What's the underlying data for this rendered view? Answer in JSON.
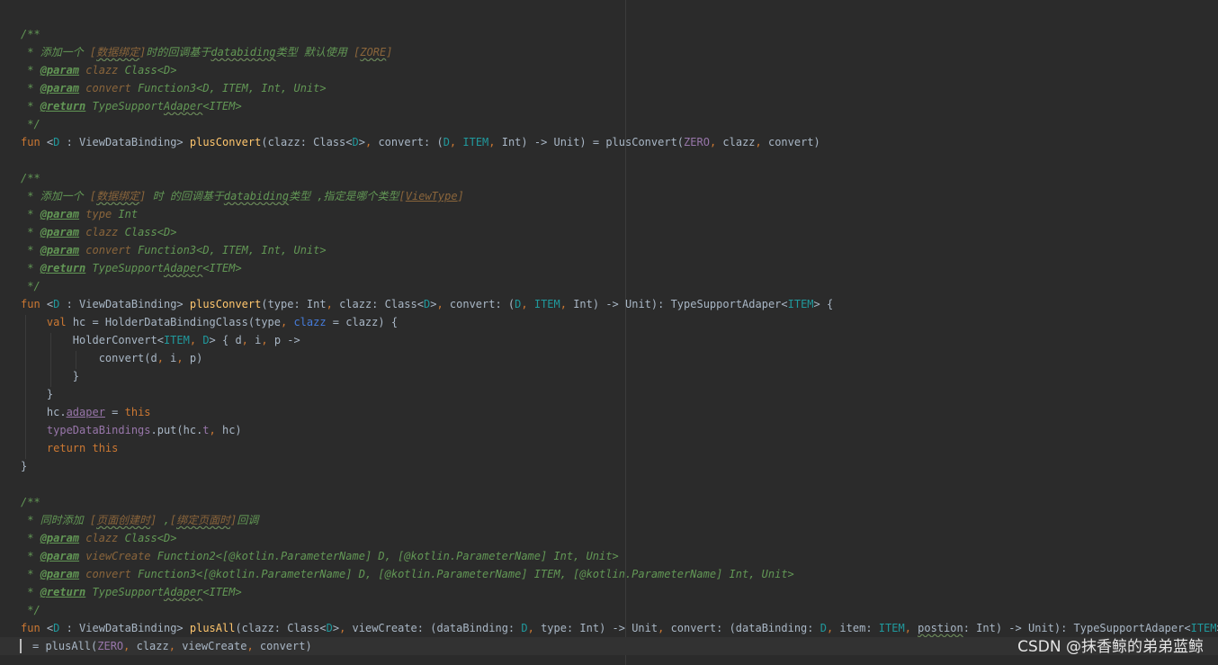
{
  "editor": {
    "watermark": "CSDN @抹香鲸的弟弟蓝鲸",
    "lines": [
      {
        "tokens": [
          {
            "t": "/**",
            "c": "comment"
          }
        ]
      },
      {
        "tokens": [
          {
            "t": " * 添加一个 ",
            "c": "comment"
          },
          {
            "t": "[",
            "c": "doc-link"
          },
          {
            "t": "数据绑定",
            "c": "doc-link",
            "u": "squiggle"
          },
          {
            "t": "]",
            "c": "doc-link"
          },
          {
            "t": "时的回调基于",
            "c": "comment"
          },
          {
            "t": "databiding",
            "c": "comment",
            "u": "squiggle"
          },
          {
            "t": "类型 默认使用 ",
            "c": "comment"
          },
          {
            "t": "[",
            "c": "doc-link"
          },
          {
            "t": "ZORE",
            "c": "doc-link",
            "u": "squiggle"
          },
          {
            "t": "]",
            "c": "doc-link"
          }
        ]
      },
      {
        "tokens": [
          {
            "t": " * ",
            "c": "comment"
          },
          {
            "t": "@param",
            "c": "tag"
          },
          {
            "t": " ",
            "c": "comment"
          },
          {
            "t": "clazz",
            "c": "doc-param"
          },
          {
            "t": " Class<D>",
            "c": "comment"
          }
        ]
      },
      {
        "tokens": [
          {
            "t": " * ",
            "c": "comment"
          },
          {
            "t": "@param",
            "c": "tag"
          },
          {
            "t": " ",
            "c": "comment"
          },
          {
            "t": "convert",
            "c": "doc-param"
          },
          {
            "t": " Function3<D, ITEM, Int, Unit>",
            "c": "comment"
          }
        ]
      },
      {
        "tokens": [
          {
            "t": " * ",
            "c": "comment"
          },
          {
            "t": "@return",
            "c": "tag"
          },
          {
            "t": " TypeSupport",
            "c": "comment"
          },
          {
            "t": "Adaper",
            "c": "comment",
            "u": "squiggle"
          },
          {
            "t": "<ITEM>",
            "c": "comment"
          }
        ]
      },
      {
        "tokens": [
          {
            "t": " */",
            "c": "comment"
          }
        ]
      },
      {
        "tokens": [
          {
            "t": "fun ",
            "c": "kw"
          },
          {
            "t": "<",
            "c": "plain"
          },
          {
            "t": "D",
            "c": "tp"
          },
          {
            "t": " : ViewDataBinding> ",
            "c": "plain"
          },
          {
            "t": "plusConvert",
            "c": "fn"
          },
          {
            "t": "(clazz: Class<",
            "c": "plain"
          },
          {
            "t": "D",
            "c": "tp"
          },
          {
            "t": ">",
            "c": "plain"
          },
          {
            "t": ", ",
            "c": "kw"
          },
          {
            "t": "convert: (",
            "c": "plain"
          },
          {
            "t": "D",
            "c": "tp"
          },
          {
            "t": ", ",
            "c": "kw"
          },
          {
            "t": "ITEM",
            "c": "tp"
          },
          {
            "t": ", ",
            "c": "kw"
          },
          {
            "t": "Int) -> Unit) = plusConvert(",
            "c": "plain"
          },
          {
            "t": "ZERO",
            "c": "prop"
          },
          {
            "t": ", ",
            "c": "kw"
          },
          {
            "t": "clazz",
            "c": "plain"
          },
          {
            "t": ", ",
            "c": "kw"
          },
          {
            "t": "convert)",
            "c": "plain"
          }
        ]
      },
      {
        "tokens": []
      },
      {
        "tokens": [
          {
            "t": "/**",
            "c": "comment"
          }
        ]
      },
      {
        "tokens": [
          {
            "t": " * 添加一个 ",
            "c": "comment"
          },
          {
            "t": "[",
            "c": "doc-link"
          },
          {
            "t": "数据绑定",
            "c": "doc-link",
            "u": "squiggle"
          },
          {
            "t": "]",
            "c": "doc-link"
          },
          {
            "t": " 时 的回调基于",
            "c": "comment"
          },
          {
            "t": "databiding",
            "c": "comment",
            "u": "squiggle"
          },
          {
            "t": "类型 ,指定是哪个类型",
            "c": "comment"
          },
          {
            "t": "[",
            "c": "doc-link"
          },
          {
            "t": "ViewType",
            "c": "doc-link",
            "u": "underline"
          },
          {
            "t": "]",
            "c": "doc-link"
          }
        ]
      },
      {
        "tokens": [
          {
            "t": " * ",
            "c": "comment"
          },
          {
            "t": "@param",
            "c": "tag"
          },
          {
            "t": " ",
            "c": "comment"
          },
          {
            "t": "type",
            "c": "doc-param"
          },
          {
            "t": " Int",
            "c": "comment"
          }
        ]
      },
      {
        "tokens": [
          {
            "t": " * ",
            "c": "comment"
          },
          {
            "t": "@param",
            "c": "tag"
          },
          {
            "t": " ",
            "c": "comment"
          },
          {
            "t": "clazz",
            "c": "doc-param"
          },
          {
            "t": " Class<D>",
            "c": "comment"
          }
        ]
      },
      {
        "tokens": [
          {
            "t": " * ",
            "c": "comment"
          },
          {
            "t": "@param",
            "c": "tag"
          },
          {
            "t": " ",
            "c": "comment"
          },
          {
            "t": "convert",
            "c": "doc-param"
          },
          {
            "t": " Function3<D, ITEM, Int, Unit>",
            "c": "comment"
          }
        ]
      },
      {
        "tokens": [
          {
            "t": " * ",
            "c": "comment"
          },
          {
            "t": "@return",
            "c": "tag"
          },
          {
            "t": " TypeSupport",
            "c": "comment"
          },
          {
            "t": "Adaper",
            "c": "comment",
            "u": "squiggle"
          },
          {
            "t": "<ITEM>",
            "c": "comment"
          }
        ]
      },
      {
        "tokens": [
          {
            "t": " */",
            "c": "comment"
          }
        ]
      },
      {
        "tokens": [
          {
            "t": "fun ",
            "c": "kw"
          },
          {
            "t": "<",
            "c": "plain"
          },
          {
            "t": "D",
            "c": "tp"
          },
          {
            "t": " : ViewDataBinding> ",
            "c": "plain"
          },
          {
            "t": "plusConvert",
            "c": "fn"
          },
          {
            "t": "(type: Int",
            "c": "plain"
          },
          {
            "t": ", ",
            "c": "kw"
          },
          {
            "t": "clazz: Class<",
            "c": "plain"
          },
          {
            "t": "D",
            "c": "tp"
          },
          {
            "t": ">",
            "c": "plain"
          },
          {
            "t": ", ",
            "c": "kw"
          },
          {
            "t": "convert: (",
            "c": "plain"
          },
          {
            "t": "D",
            "c": "tp"
          },
          {
            "t": ", ",
            "c": "kw"
          },
          {
            "t": "ITEM",
            "c": "tp"
          },
          {
            "t": ", ",
            "c": "kw"
          },
          {
            "t": "Int) -> Unit): TypeSupportAdaper<",
            "c": "plain"
          },
          {
            "t": "ITEM",
            "c": "tp"
          },
          {
            "t": "> {",
            "c": "plain"
          }
        ]
      },
      {
        "tokens": [
          {
            "t": "    ",
            "c": "plain"
          },
          {
            "t": "val ",
            "c": "kw"
          },
          {
            "t": "hc = HolderDataBindingClass(type",
            "c": "plain"
          },
          {
            "t": ", ",
            "c": "kw"
          },
          {
            "t": "clazz",
            "c": "named"
          },
          {
            "t": " = clazz) {",
            "c": "plain"
          }
        ]
      },
      {
        "tokens": [
          {
            "t": "        HolderConvert<",
            "c": "plain"
          },
          {
            "t": "ITEM",
            "c": "tp"
          },
          {
            "t": ", ",
            "c": "kw"
          },
          {
            "t": "D",
            "c": "tp"
          },
          {
            "t": "> { d",
            "c": "plain"
          },
          {
            "t": ", ",
            "c": "kw"
          },
          {
            "t": "i",
            "c": "plain"
          },
          {
            "t": ", ",
            "c": "kw"
          },
          {
            "t": "p ->",
            "c": "plain"
          }
        ]
      },
      {
        "tokens": [
          {
            "t": "            convert(d",
            "c": "plain"
          },
          {
            "t": ", ",
            "c": "kw"
          },
          {
            "t": "i",
            "c": "plain"
          },
          {
            "t": ", ",
            "c": "kw"
          },
          {
            "t": "p)",
            "c": "plain"
          }
        ]
      },
      {
        "tokens": [
          {
            "t": "        }",
            "c": "plain"
          }
        ]
      },
      {
        "tokens": [
          {
            "t": "    }",
            "c": "plain"
          }
        ]
      },
      {
        "tokens": [
          {
            "t": "    hc.",
            "c": "plain"
          },
          {
            "t": "adaper",
            "c": "prop",
            "u": "underline"
          },
          {
            "t": " = ",
            "c": "plain"
          },
          {
            "t": "this",
            "c": "kw"
          }
        ]
      },
      {
        "tokens": [
          {
            "t": "    ",
            "c": "plain"
          },
          {
            "t": "typeDataBindings",
            "c": "prop"
          },
          {
            "t": ".put(hc.",
            "c": "plain"
          },
          {
            "t": "t",
            "c": "prop"
          },
          {
            "t": ", ",
            "c": "kw"
          },
          {
            "t": "hc)",
            "c": "plain"
          }
        ]
      },
      {
        "tokens": [
          {
            "t": "    ",
            "c": "plain"
          },
          {
            "t": "return this",
            "c": "kw"
          }
        ]
      },
      {
        "tokens": [
          {
            "t": "}",
            "c": "plain"
          }
        ]
      },
      {
        "tokens": []
      },
      {
        "tokens": [
          {
            "t": "/**",
            "c": "comment"
          }
        ]
      },
      {
        "tokens": [
          {
            "t": " * 同时添加 ",
            "c": "comment"
          },
          {
            "t": "[",
            "c": "doc-link"
          },
          {
            "t": "页面创建时",
            "c": "doc-link",
            "u": "squiggle"
          },
          {
            "t": "]",
            "c": "doc-link"
          },
          {
            "t": " ,",
            "c": "comment"
          },
          {
            "t": "[",
            "c": "doc-link"
          },
          {
            "t": "绑定页面时",
            "c": "doc-link",
            "u": "squiggle"
          },
          {
            "t": "]",
            "c": "doc-link"
          },
          {
            "t": "回调",
            "c": "comment"
          }
        ]
      },
      {
        "tokens": [
          {
            "t": " * ",
            "c": "comment"
          },
          {
            "t": "@param",
            "c": "tag"
          },
          {
            "t": " ",
            "c": "comment"
          },
          {
            "t": "clazz",
            "c": "doc-param"
          },
          {
            "t": " Class<D>",
            "c": "comment"
          }
        ]
      },
      {
        "tokens": [
          {
            "t": " * ",
            "c": "comment"
          },
          {
            "t": "@param",
            "c": "tag"
          },
          {
            "t": " ",
            "c": "comment"
          },
          {
            "t": "viewCreate",
            "c": "doc-param"
          },
          {
            "t": " Function2<[@kotlin.ParameterName] D, [@kotlin.ParameterName] Int, Unit>",
            "c": "comment"
          }
        ]
      },
      {
        "tokens": [
          {
            "t": " * ",
            "c": "comment"
          },
          {
            "t": "@param",
            "c": "tag"
          },
          {
            "t": " ",
            "c": "comment"
          },
          {
            "t": "convert",
            "c": "doc-param"
          },
          {
            "t": " Function3<[@kotlin.ParameterName] D, [@kotlin.ParameterName] ITEM, [@kotlin.ParameterName] Int, Unit>",
            "c": "comment"
          }
        ]
      },
      {
        "tokens": [
          {
            "t": " * ",
            "c": "comment"
          },
          {
            "t": "@return",
            "c": "tag"
          },
          {
            "t": " TypeSupport",
            "c": "comment"
          },
          {
            "t": "Adaper",
            "c": "comment",
            "u": "squiggle"
          },
          {
            "t": "<ITEM>",
            "c": "comment"
          }
        ]
      },
      {
        "tokens": [
          {
            "t": " */",
            "c": "comment"
          }
        ]
      },
      {
        "tokens": [
          {
            "t": "fun ",
            "c": "kw"
          },
          {
            "t": "<",
            "c": "plain"
          },
          {
            "t": "D",
            "c": "tp"
          },
          {
            "t": " : ViewDataBinding> ",
            "c": "plain"
          },
          {
            "t": "plusAll",
            "c": "fn"
          },
          {
            "t": "(clazz: Class<",
            "c": "plain"
          },
          {
            "t": "D",
            "c": "tp"
          },
          {
            "t": ">",
            "c": "plain"
          },
          {
            "t": ", ",
            "c": "kw"
          },
          {
            "t": "viewCreate: (dataBinding: ",
            "c": "plain"
          },
          {
            "t": "D",
            "c": "tp"
          },
          {
            "t": ", ",
            "c": "kw"
          },
          {
            "t": "type: Int) -> Unit",
            "c": "plain"
          },
          {
            "t": ", ",
            "c": "kw"
          },
          {
            "t": "convert: (dataBinding: ",
            "c": "plain"
          },
          {
            "t": "D",
            "c": "tp"
          },
          {
            "t": ", ",
            "c": "kw"
          },
          {
            "t": "item: ",
            "c": "plain"
          },
          {
            "t": "ITEM",
            "c": "tp"
          },
          {
            "t": ", ",
            "c": "kw"
          },
          {
            "t": "postion",
            "c": "plain",
            "u": "squiggle"
          },
          {
            "t": ": Int) -> Unit): TypeSupportAdaper<",
            "c": "plain"
          },
          {
            "t": "ITEM",
            "c": "tp"
          },
          {
            "t": ">",
            "c": "plain"
          }
        ]
      },
      {
        "tokens": [
          {
            "t": "= plusAll(",
            "c": "plain"
          },
          {
            "t": "ZERO",
            "c": "prop"
          },
          {
            "t": ", ",
            "c": "kw"
          },
          {
            "t": "clazz",
            "c": "plain"
          },
          {
            "t": ", ",
            "c": "kw"
          },
          {
            "t": "viewCreate",
            "c": "plain"
          },
          {
            "t": ", ",
            "c": "kw"
          },
          {
            "t": "convert)",
            "c": "plain"
          }
        ]
      }
    ]
  }
}
